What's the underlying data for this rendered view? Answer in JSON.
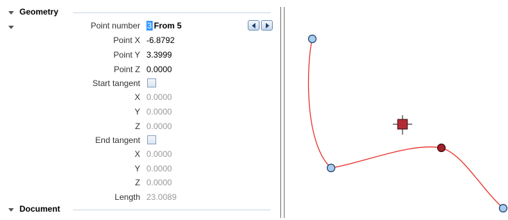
{
  "geometry": {
    "title": "Geometry",
    "point_number": {
      "label": "Point number",
      "value": "3",
      "suffix": "From 5"
    },
    "point_x": {
      "label": "Point X",
      "value": "-6.8792"
    },
    "point_y": {
      "label": "Point Y",
      "value": "3.3999"
    },
    "point_z": {
      "label": "Point Z",
      "value": "0.0000"
    },
    "start_tangent": {
      "label": "Start tangent",
      "checked": false,
      "x": {
        "label": "X",
        "value": "0.0000"
      },
      "y": {
        "label": "Y",
        "value": "0.0000"
      },
      "z": {
        "label": "Z",
        "value": "0.0000"
      }
    },
    "end_tangent": {
      "label": "End tangent",
      "checked": false,
      "x": {
        "label": "X",
        "value": "0.0000"
      },
      "y": {
        "label": "Y",
        "value": "0.0000"
      },
      "z": {
        "label": "Z",
        "value": "0.0000"
      }
    },
    "length": {
      "label": "Length",
      "value": "23.0089"
    }
  },
  "document": {
    "title": "Document"
  },
  "canvas": {
    "curve_color": "#e8332e",
    "point_fill": "#a9cdf0",
    "point_stroke": "#1f3f66",
    "selected_point_fill": "#a3202c",
    "center_marker_fill": "#b32a35"
  }
}
